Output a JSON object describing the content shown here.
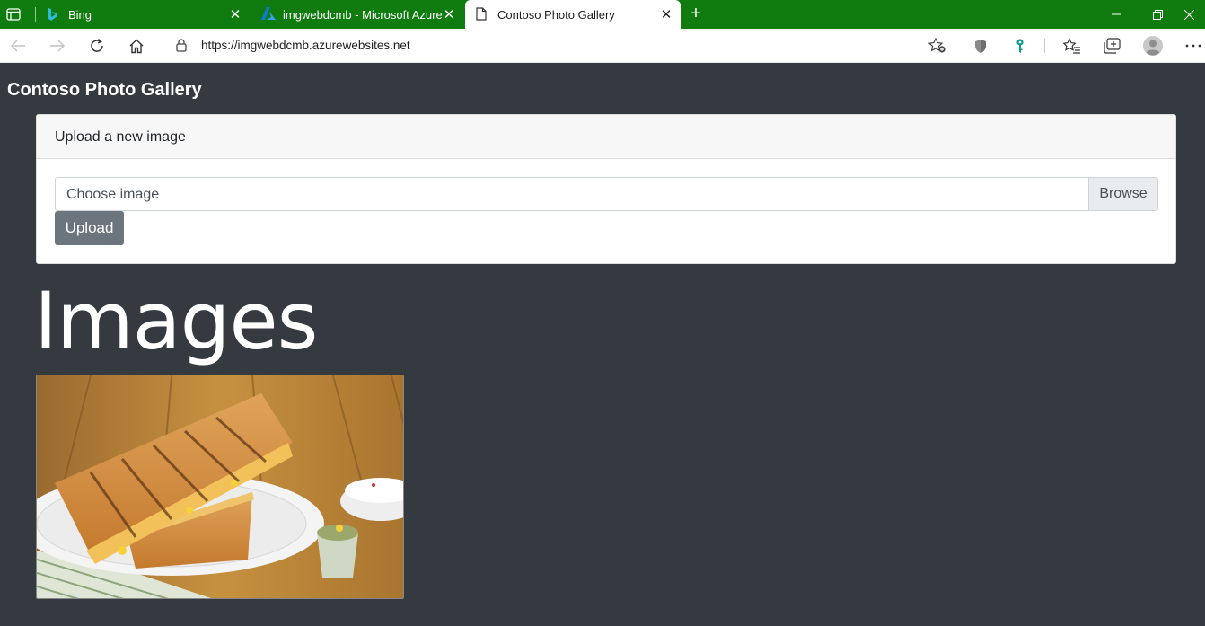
{
  "browser": {
    "tabs": [
      {
        "title": "Bing",
        "icon": "bing-logo-icon",
        "active": false
      },
      {
        "title": "imgwebdcmb - Microsoft Azure",
        "icon": "azure-logo-icon",
        "active": false
      },
      {
        "title": "Contoso Photo Gallery",
        "icon": "page-icon",
        "active": true
      }
    ],
    "address_bar": {
      "url": "https://imgwebdcmb.azurewebsites.net"
    },
    "colors": {
      "tab_strip": "#107c10",
      "page_background": "#343a40"
    }
  },
  "site": {
    "brand": "Contoso Photo Gallery",
    "upload_card": {
      "title": "Upload a new image",
      "file_placeholder": "Choose image",
      "browse_label": "Browse",
      "upload_label": "Upload"
    },
    "images_heading": "Images",
    "images": [
      {
        "alt": "grilled-sandwich-photo"
      }
    ]
  }
}
